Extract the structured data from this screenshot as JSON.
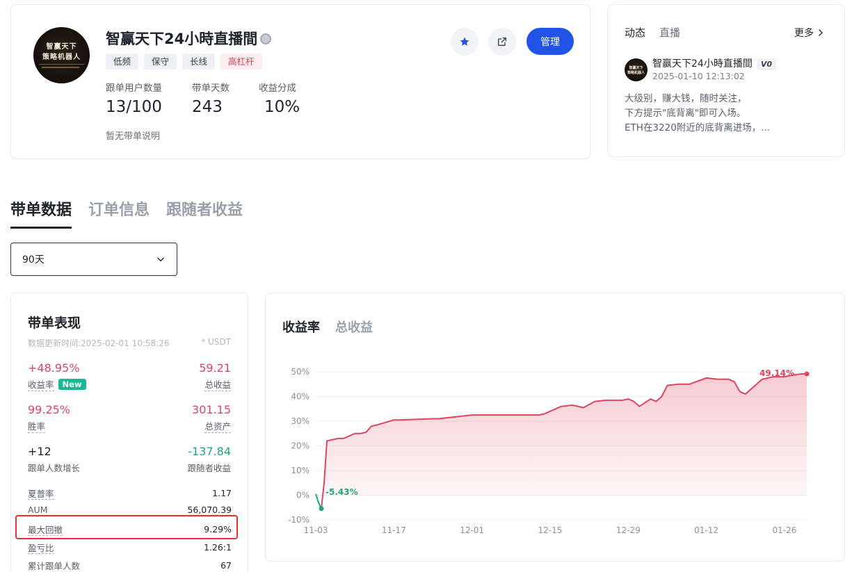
{
  "profile": {
    "avatar_line1": "智赢天下",
    "avatar_line2": "策略机器人",
    "title": "智赢天下24小時直播間",
    "tags": [
      "低频",
      "保守",
      "长线",
      "高杠杆"
    ],
    "stats": [
      {
        "label": "跟单用户数量",
        "value": "13/100"
      },
      {
        "label": "带单天数",
        "value": "243"
      },
      {
        "label": "收益分成",
        "value": "10%"
      }
    ],
    "note": "暂无带单说明",
    "manage_label": "管理"
  },
  "feed": {
    "tab_active": "动态",
    "tab_inactive": "直播",
    "more_label": "更多",
    "post": {
      "name": "智赢天下24小時直播間",
      "badge": "V0",
      "time": "2025-01-10 12:13:02",
      "lines": [
        "大级别，赚大钱，随时关注，",
        "下方提示\"底背离\"即可入场。",
        "ETH在3220附近的底背离进场，..."
      ]
    }
  },
  "main_tabs": [
    "带单数据",
    "订单信息",
    "跟随者收益"
  ],
  "period_select": {
    "value": "90天"
  },
  "performance": {
    "title": "带单表现",
    "updated": "数据更新时间:2025-02-01 10:58:26",
    "unit": "* USDT",
    "metrics": [
      {
        "value": "+48.95%",
        "label": "收益率",
        "badge": "New",
        "color": "#e0455f"
      },
      {
        "value": "59.21",
        "label": "总收益",
        "color": "#e0455f"
      },
      {
        "value": "99.25%",
        "label": "胜率",
        "color": "#e0455f"
      },
      {
        "value": "301.15",
        "label": "总资产",
        "color": "#e0455f"
      },
      {
        "value": "+12",
        "label": "跟单人数增长",
        "color": "#1f2329"
      },
      {
        "value": "-137.84",
        "label": "跟随者收益",
        "color": "#21a674"
      }
    ],
    "rows": [
      {
        "label": "夏普率",
        "value": "1.17"
      },
      {
        "label": "AUM",
        "value": "56,070.39"
      },
      {
        "label": "最大回撤",
        "value": "9.29%"
      },
      {
        "label": "盈亏比",
        "value": "1.26:1"
      },
      {
        "label": "累计跟单人数",
        "value": "67"
      }
    ]
  },
  "chart_tabs": [
    "收益率",
    "总收益"
  ],
  "chart_data": {
    "type": "area",
    "x_ticks": [
      "11-03",
      "11-17",
      "12-01",
      "12-15",
      "12-29",
      "01-12",
      "01-26"
    ],
    "y_ticks": [
      "50%",
      "40%",
      "30%",
      "20%",
      "10%",
      "0%",
      "-10%"
    ],
    "ylim": [
      -10,
      50
    ],
    "grid": true,
    "series": [
      {
        "x": [
          0,
          0.5,
          1,
          1.5,
          2,
          4,
          5,
          7,
          8,
          9,
          10,
          11,
          14,
          15,
          21,
          22,
          28,
          29,
          35,
          36,
          37,
          38,
          40,
          41,
          44,
          46,
          48,
          50,
          52,
          55,
          56,
          57,
          58,
          60,
          61,
          62,
          63,
          65,
          67,
          70,
          72,
          74,
          75,
          76,
          77,
          79,
          80,
          82,
          84,
          85,
          87,
          88
        ],
        "y": [
          0.5,
          -3,
          -5.43,
          5,
          22,
          23,
          23,
          25,
          25,
          25.5,
          28,
          28.5,
          30.5,
          30.5,
          31,
          31,
          32.5,
          32.5,
          32.5,
          32.5,
          32.5,
          32.5,
          32.5,
          33,
          36,
          36.5,
          35.5,
          38,
          38.5,
          38.5,
          39,
          38,
          36,
          39,
          38,
          40,
          44.5,
          45,
          45,
          47.5,
          47,
          47,
          46,
          42,
          41,
          45,
          47,
          48,
          48,
          48.5,
          49.14,
          49.14
        ]
      }
    ],
    "annotations": [
      {
        "text": "49.14%",
        "color": "#e0455f"
      },
      {
        "text": "-5.43%",
        "color": "#21a674"
      }
    ]
  }
}
